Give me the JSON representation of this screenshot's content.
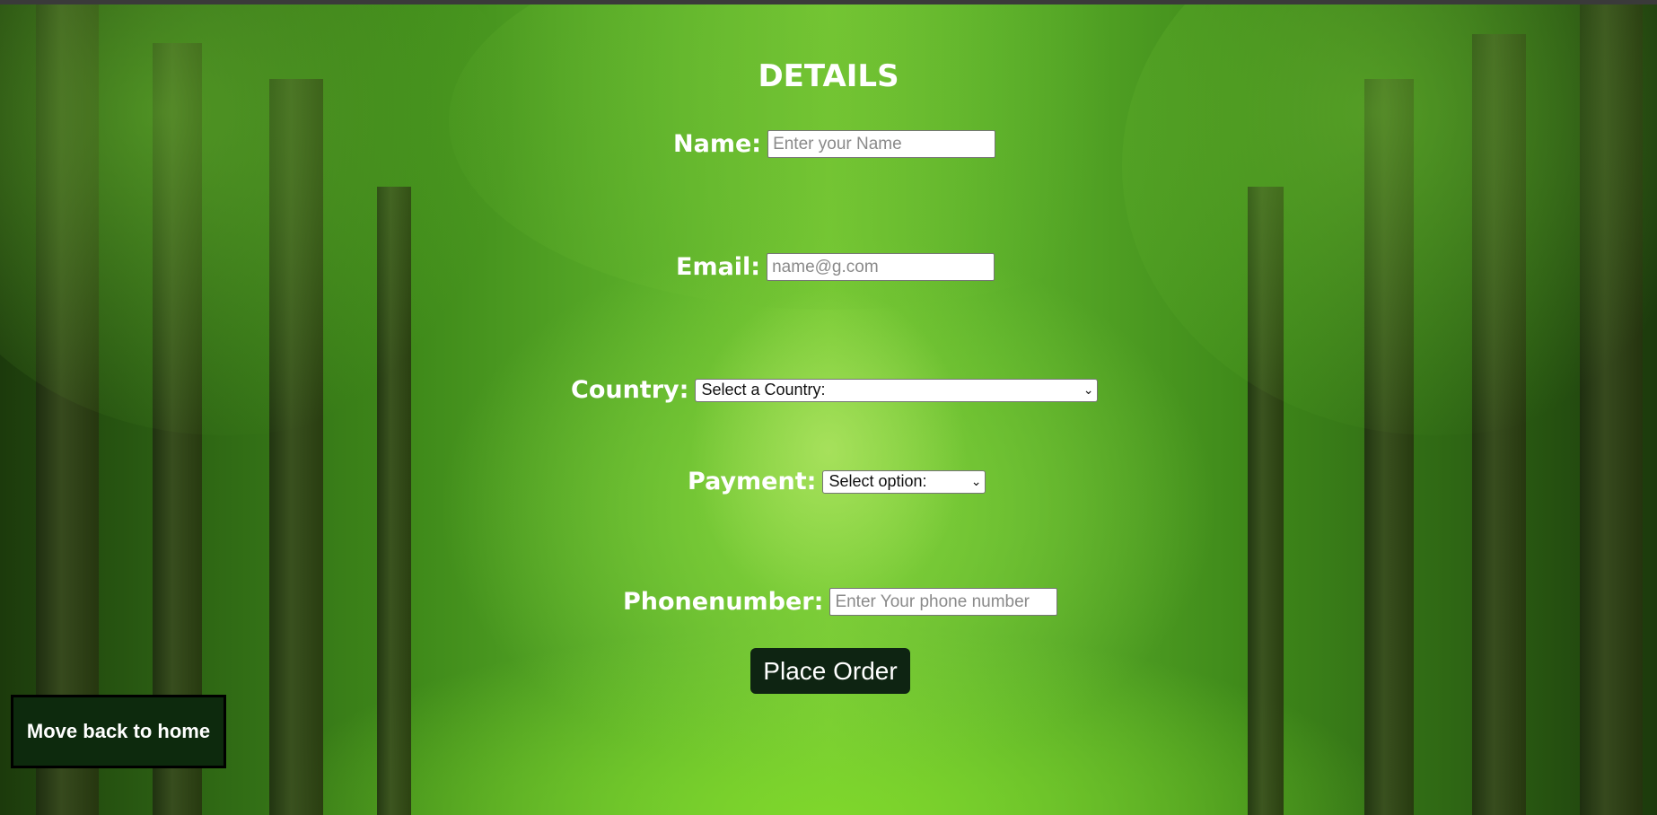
{
  "page": {
    "title": "DETAILS"
  },
  "form": {
    "name": {
      "label": "Name:",
      "placeholder": "Enter your Name",
      "value": ""
    },
    "email": {
      "label": "Email:",
      "placeholder": "name@g.com",
      "value": ""
    },
    "country": {
      "label": "Country:",
      "selected": "Select a Country:"
    },
    "payment": {
      "label": "Payment:",
      "selected": "Select option:"
    },
    "phone": {
      "label": "Phonenumber:",
      "placeholder": "Enter Your phone number",
      "value": ""
    },
    "submit_label": "Place Order"
  },
  "nav": {
    "home_label": "Move back to home"
  },
  "icons": {
    "dropdown": "chevron-down-icon"
  }
}
